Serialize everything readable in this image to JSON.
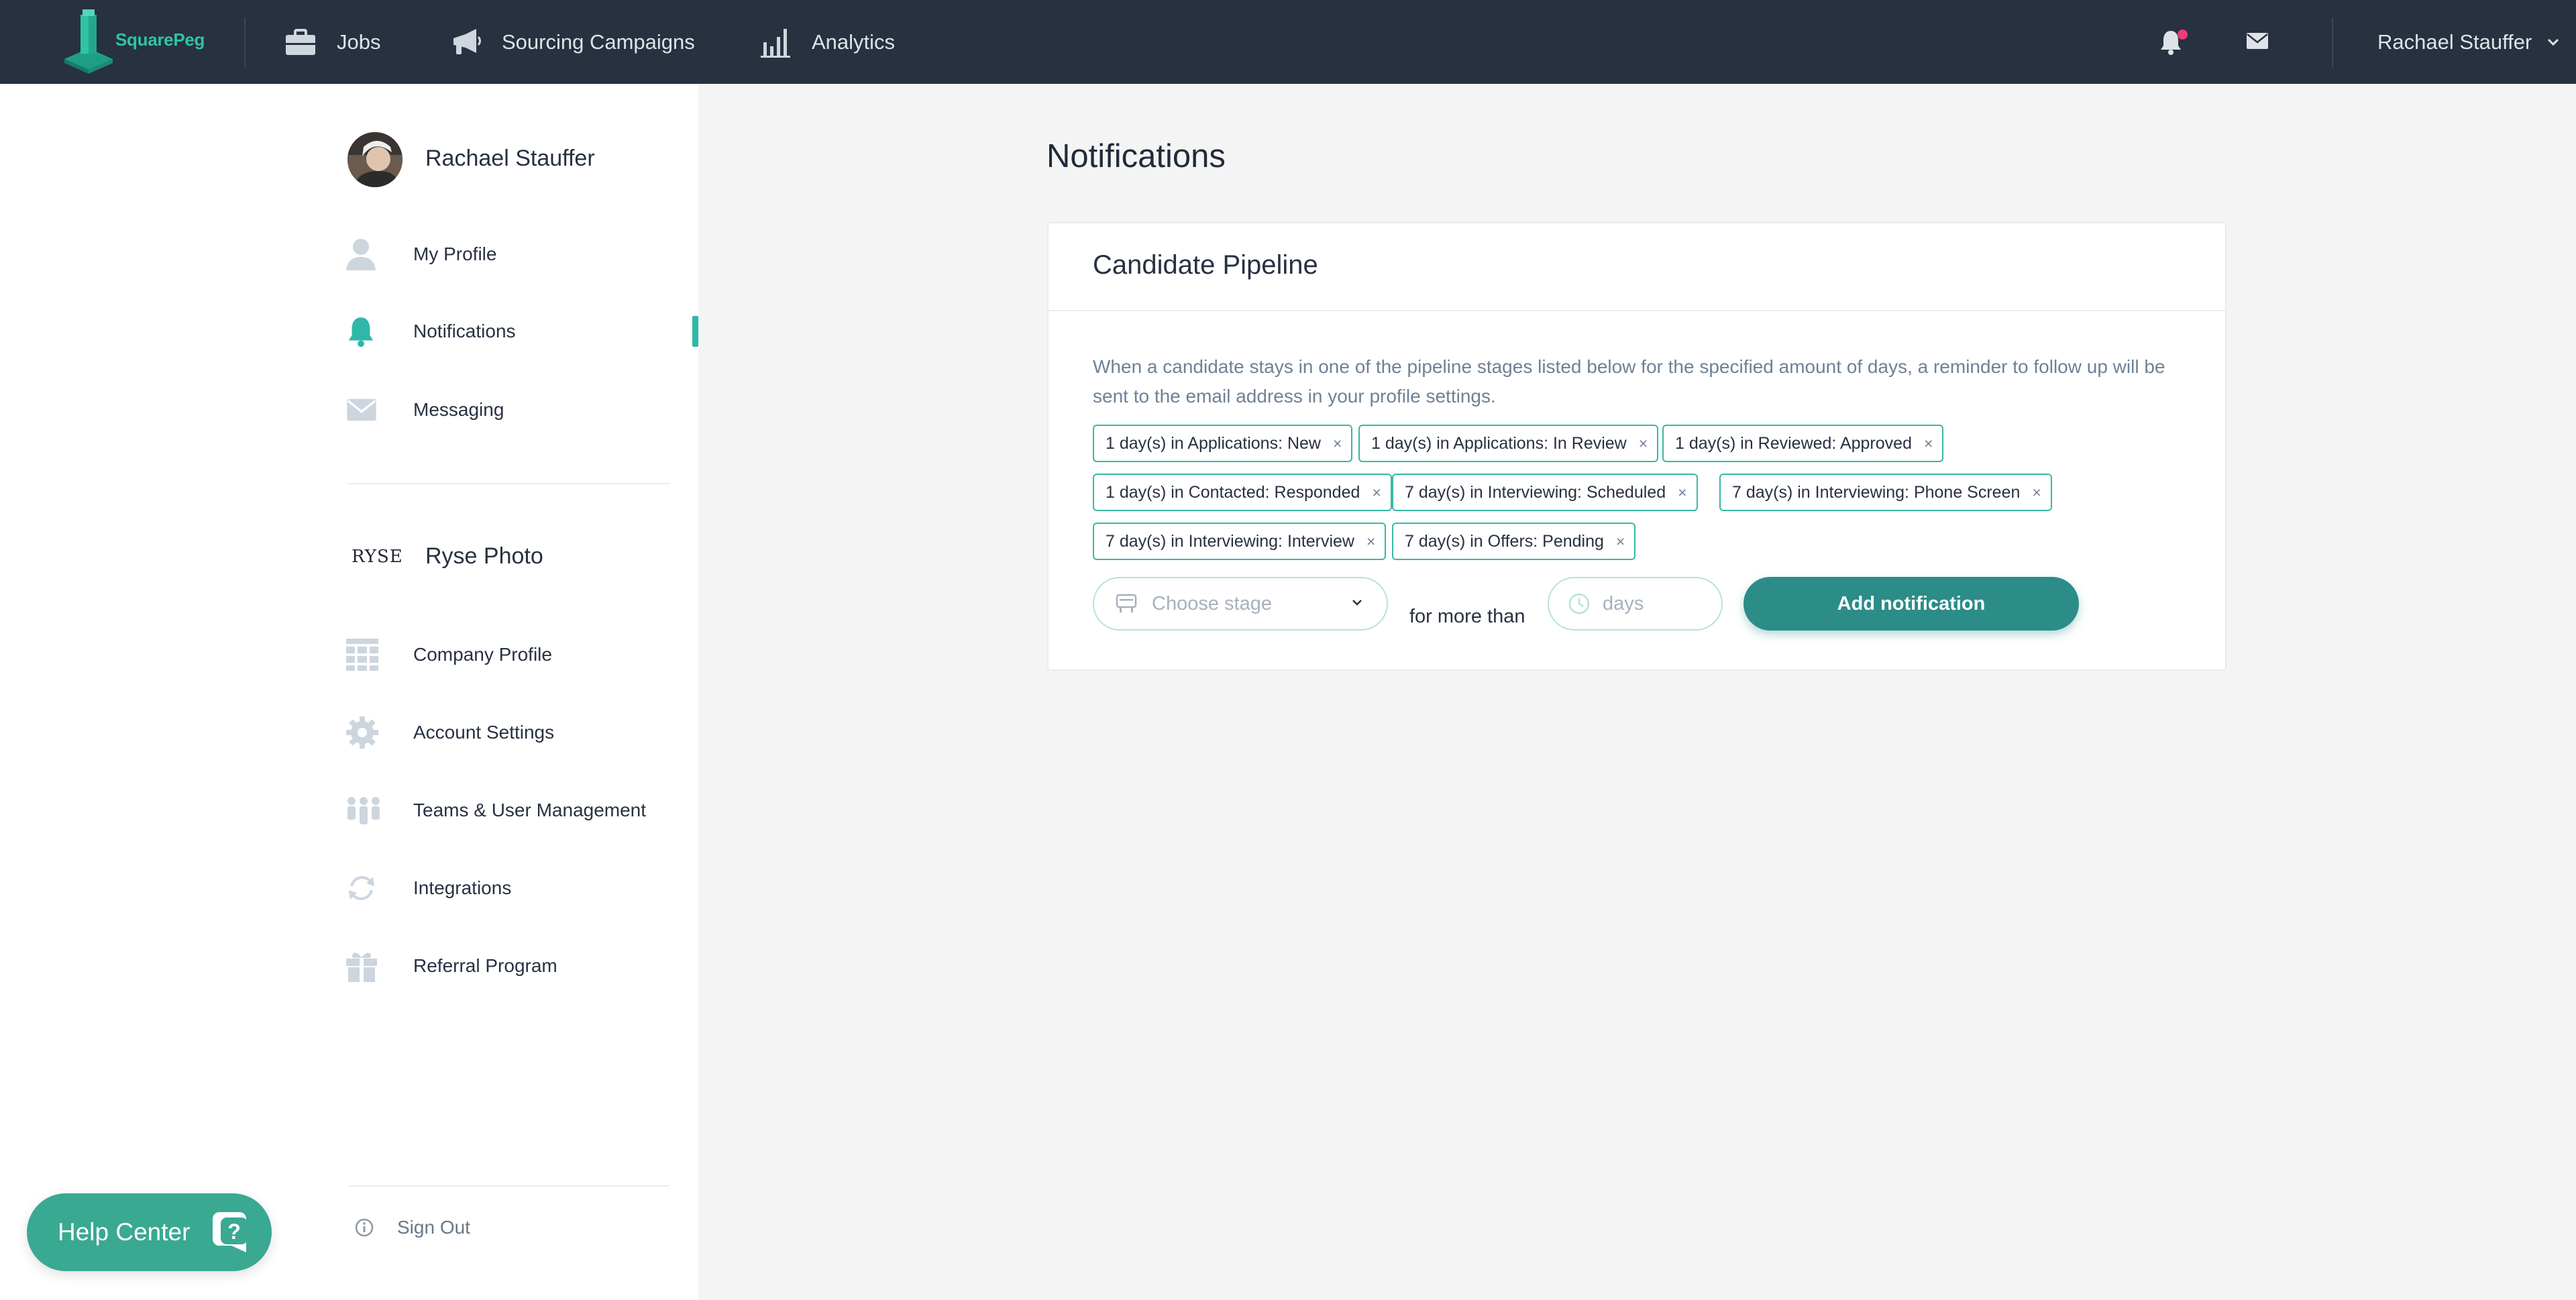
{
  "app": {
    "brand": "SquarePeg",
    "accent_color": "#2fb7a9",
    "header_color": "#27313f"
  },
  "topnav": {
    "items": [
      {
        "label": "Jobs",
        "icon": "briefcase-icon"
      },
      {
        "label": "Sourcing Campaigns",
        "icon": "megaphone-icon"
      },
      {
        "label": "Analytics",
        "icon": "bar-chart-icon"
      }
    ],
    "notification_icon": "bell-icon",
    "has_unread_notifications": true,
    "message_icon": "envelope-icon",
    "user_name": "Rachael Stauffer",
    "user_menu_icon": "chevron-down-icon"
  },
  "sidebar": {
    "profile_name": "Rachael Stauffer",
    "personal_items": [
      {
        "label": "My Profile",
        "icon": "person-icon"
      },
      {
        "label": "Notifications",
        "icon": "bell-icon",
        "active": true
      },
      {
        "label": "Messaging",
        "icon": "envelope-icon"
      }
    ],
    "company_logo_text": "RYSE",
    "company_name": "Ryse Photo",
    "company_items": [
      {
        "label": "Company Profile",
        "icon": "building-icon"
      },
      {
        "label": "Account Settings",
        "icon": "gear-icon"
      },
      {
        "label": "Teams & User Management",
        "icon": "team-icon"
      },
      {
        "label": "Integrations",
        "icon": "sync-icon"
      },
      {
        "label": "Referral Program",
        "icon": "gift-icon"
      }
    ],
    "sign_out_label": "Sign Out"
  },
  "help_center": {
    "label": "Help Center"
  },
  "main": {
    "page_title": "Notifications",
    "card": {
      "title": "Candidate Pipeline",
      "description": "When a candidate stays in one of the pipeline stages listed below for the specified amount of days, a reminder to follow up will be sent to the email address in your profile settings.",
      "tags": [
        "1 day(s) in Applications: New",
        "1 day(s) in Applications: In Review",
        "1 day(s) in Reviewed: Approved",
        "1 day(s) in Contacted: Responded",
        "7 day(s) in Interviewing: Scheduled",
        "7 day(s) in Interviewing: Phone Screen",
        "7 day(s) in Interviewing: Interview",
        "7 day(s) in Offers: Pending"
      ],
      "remove_symbol": "×",
      "stage_select_placeholder": "Choose stage",
      "for_more_than_label": "for more than",
      "days_placeholder": "days",
      "days_value": "",
      "add_button_label": "Add notification"
    }
  }
}
